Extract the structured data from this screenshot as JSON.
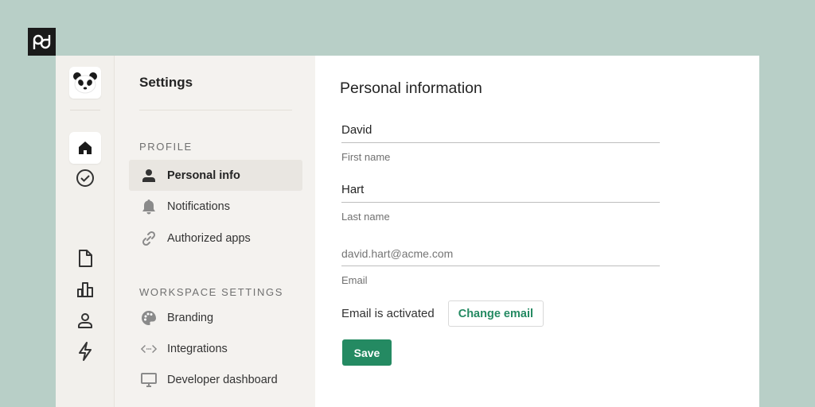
{
  "brand": {
    "logo_text": "pd"
  },
  "rail": {
    "items": [
      {
        "icon": "panda-logo-icon"
      },
      {
        "icon": "home-icon",
        "active": true
      },
      {
        "icon": "check-circle-icon"
      },
      {
        "icon": "document-icon"
      },
      {
        "icon": "bar-chart-icon"
      },
      {
        "icon": "person-icon"
      },
      {
        "icon": "lightning-icon"
      }
    ]
  },
  "sidebar": {
    "title": "Settings",
    "profile_label": "PROFILE",
    "profile_items": [
      {
        "label": "Personal info",
        "icon": "person-icon",
        "active": true
      },
      {
        "label": "Notifications",
        "icon": "bell-icon"
      },
      {
        "label": "Authorized apps",
        "icon": "link-icon"
      }
    ],
    "workspace_label": "WORKSPACE SETTINGS",
    "workspace_items": [
      {
        "label": "Branding",
        "icon": "palette-icon"
      },
      {
        "label": "Integrations",
        "icon": "code-icon"
      },
      {
        "label": "Developer dashboard",
        "icon": "monitor-icon"
      }
    ]
  },
  "main": {
    "heading": "Personal information",
    "first_name": {
      "value": "David",
      "label": "First name"
    },
    "last_name": {
      "value": "Hart",
      "label": "Last name"
    },
    "email": {
      "placeholder": "david.hart@acme.com",
      "label": "Email"
    },
    "email_status": "Email is activated",
    "change_email_label": "Change email",
    "save_label": "Save"
  },
  "colors": {
    "accent": "#248a62",
    "background": "#b8cfc7"
  }
}
